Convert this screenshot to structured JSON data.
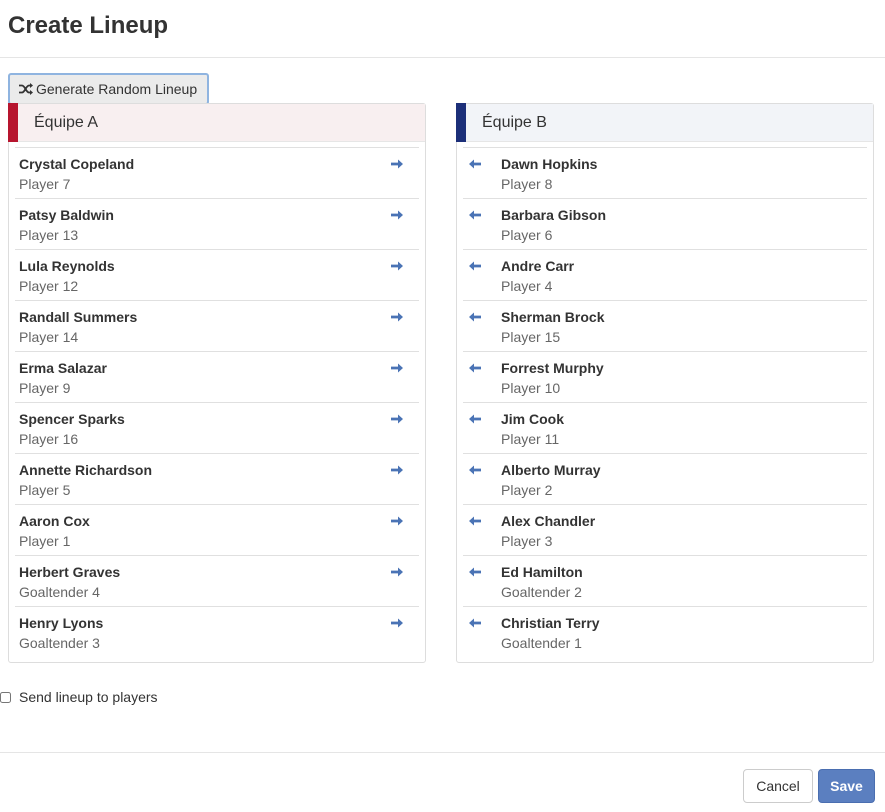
{
  "modal": {
    "title": "Create Lineup"
  },
  "generate_button": {
    "label": "Generate Random Lineup",
    "icon": "shuffle-icon"
  },
  "colors": {
    "team_a_accent": "#b7152e",
    "team_b_accent": "#1c2f79",
    "arrow": "#4a73b5",
    "save_button": "#5b7fc0"
  },
  "team_a": {
    "name": "Équipe A",
    "move_icon": "arrow-right-icon",
    "players": [
      {
        "name": "Crystal Copeland",
        "position": "Player 7"
      },
      {
        "name": "Patsy Baldwin",
        "position": "Player 13"
      },
      {
        "name": "Lula Reynolds",
        "position": "Player 12"
      },
      {
        "name": "Randall Summers",
        "position": "Player 14"
      },
      {
        "name": "Erma Salazar",
        "position": "Player 9"
      },
      {
        "name": "Spencer Sparks",
        "position": "Player 16"
      },
      {
        "name": "Annette Richardson",
        "position": "Player 5"
      },
      {
        "name": "Aaron Cox",
        "position": "Player 1"
      },
      {
        "name": "Herbert Graves",
        "position": "Goaltender 4"
      },
      {
        "name": "Henry Lyons",
        "position": "Goaltender 3"
      }
    ]
  },
  "team_b": {
    "name": "Équipe B",
    "move_icon": "arrow-left-icon",
    "players": [
      {
        "name": "Dawn Hopkins",
        "position": "Player 8"
      },
      {
        "name": "Barbara Gibson",
        "position": "Player 6"
      },
      {
        "name": "Andre Carr",
        "position": "Player 4"
      },
      {
        "name": "Sherman Brock",
        "position": "Player 15"
      },
      {
        "name": "Forrest Murphy",
        "position": "Player 10"
      },
      {
        "name": "Jim Cook",
        "position": "Player 11"
      },
      {
        "name": "Alberto Murray",
        "position": "Player 2"
      },
      {
        "name": "Alex Chandler",
        "position": "Player 3"
      },
      {
        "name": "Ed Hamilton",
        "position": "Goaltender 2"
      },
      {
        "name": "Christian Terry",
        "position": "Goaltender 1"
      }
    ]
  },
  "send_lineup": {
    "label": "Send lineup to players",
    "checked": false
  },
  "footer": {
    "cancel_label": "Cancel",
    "save_label": "Save"
  }
}
